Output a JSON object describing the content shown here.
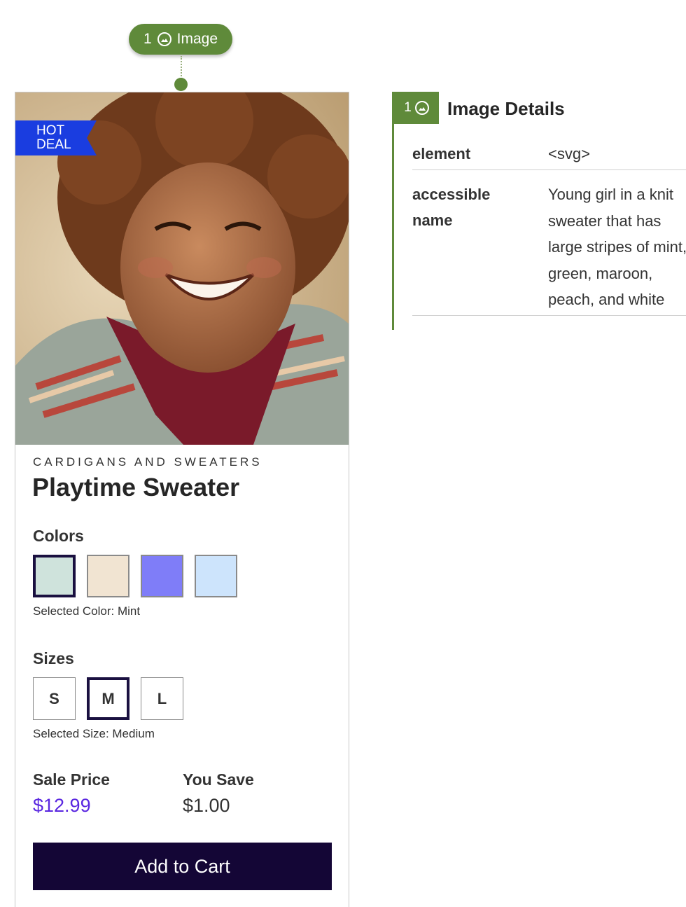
{
  "annotation": {
    "pill": {
      "number": "1",
      "label": "Image"
    }
  },
  "product": {
    "badge": {
      "line1": "HOT",
      "line2": "DEAL"
    },
    "photo_icon": "girl-in-knit-sweater-photo",
    "category": "CARDIGANS AND SWEATERS",
    "title": "Playtime Sweater",
    "colors": {
      "label": "Colors",
      "swatches": [
        "#cfe3dc",
        "#f1e4d2",
        "#7f7df8",
        "#cde4fc"
      ],
      "selected_index": 0,
      "selected_note": "Selected Color: Mint"
    },
    "sizes": {
      "label": "Sizes",
      "options": [
        "S",
        "M",
        "L"
      ],
      "selected_index": 1,
      "selected_note": "Selected Size: Medium"
    },
    "pricing": {
      "sale_label": "Sale Price",
      "sale_value": "$12.99",
      "save_label": "You Save",
      "save_value": "$1.00"
    },
    "add_to_cart": "Add to Cart"
  },
  "details_panel": {
    "tab_number": "1",
    "title": "Image Details",
    "rows": [
      {
        "key": "element",
        "value": "<svg>"
      },
      {
        "key": "accessible\nname",
        "value": "Young girl in a knit\nsweater that has\nlarge stripes of mint,\ngreen, maroon,\npeach, and white"
      }
    ]
  },
  "colors": {
    "accent_green": "#5f8a3a",
    "hot_deal_blue": "#1a3de0",
    "cart_button": "#140636",
    "sale_price": "#5a27e0"
  }
}
